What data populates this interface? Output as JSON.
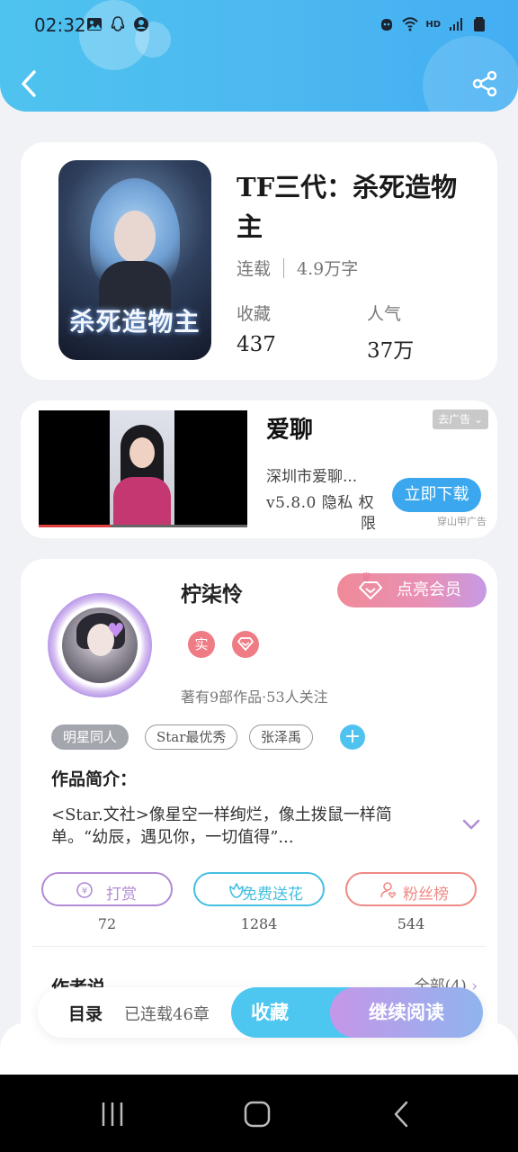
{
  "status_bar": {
    "time": "02:32",
    "left_icons": [
      "image-icon",
      "qq-icon",
      "account-icon"
    ],
    "right_icons": [
      "alarm-icon",
      "wifi-icon",
      "signal-icon",
      "battery-icon"
    ],
    "hd_label": "HD"
  },
  "header": {
    "back_icon": "chevron-left-icon",
    "share_icon": "share-icon",
    "accent_color": "#4bb7f0"
  },
  "book": {
    "cover_title": "杀死造物主",
    "title": "TF三代：杀死造物主",
    "status": "连载",
    "word_count": "4.9万字",
    "stats": [
      {
        "label": "收藏",
        "value": "437"
      },
      {
        "label": "人气",
        "value": "37万"
      }
    ]
  },
  "ad": {
    "title": "爱聊",
    "remove_label": "去广告",
    "description": "深圳市爱聊...",
    "version": "v5.8.0 隐私 权",
    "version_cont": "限",
    "download_label": "立即下载",
    "source": "穿山甲广告"
  },
  "author": {
    "name": "柠柒怜",
    "vip_label": "点亮会员",
    "verify_badge": "实",
    "stats_text": "著有9部作品·53人关注",
    "tags": [
      "明星同人",
      "Star最优秀",
      "张泽禹"
    ],
    "intro_label": "作品简介：",
    "intro_text": "<Star.文社>像星空一样绚烂，像土拨鼠一样简单。“幼辰，遇见你，一切值得”...",
    "actions": [
      {
        "label": "打赏",
        "count": "72",
        "color": "#b28ad6"
      },
      {
        "label": "免费送花",
        "count": "1284",
        "color": "#45bfe0"
      },
      {
        "label": "粉丝榜",
        "count": "544",
        "color": "#ee8a86"
      }
    ],
    "author_says_label": "作者说",
    "see_all_label": "全部(4)"
  },
  "bottom_bar": {
    "toc_label": "目录",
    "chapters_label": "已连载46章",
    "favorite_label": "收藏",
    "read_label": "继续阅读"
  },
  "nav_bar": {
    "items": [
      "recents-icon",
      "home-icon",
      "back-icon"
    ]
  }
}
